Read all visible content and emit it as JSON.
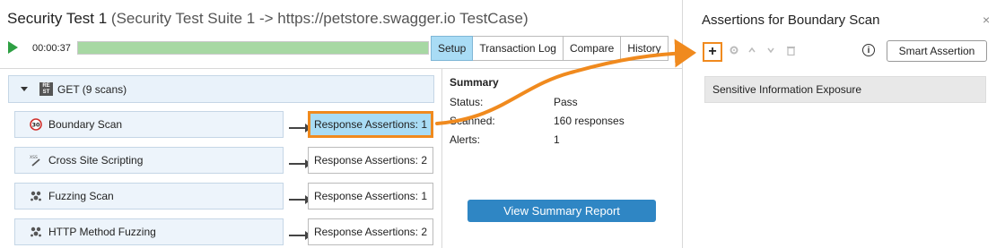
{
  "header": {
    "title": "Security Test 1",
    "subtitle": "(Security Test Suite 1 -> https://petstore.swagger.io TestCase)",
    "timer": "00:00:37",
    "progress": 1.0,
    "tabs": [
      "Setup",
      "Transaction Log",
      "Compare",
      "History"
    ],
    "active_tab": "Setup"
  },
  "group": {
    "label": "GET (9 scans)",
    "icon_text": "RE ST"
  },
  "scans": [
    {
      "name": "Boundary Scan",
      "icon": "boundary-icon",
      "assertions": "Response Assertions: 1",
      "highlighted": true
    },
    {
      "name": "Cross Site Scripting",
      "icon": "xss-icon",
      "assertions": "Response Assertions: 2",
      "highlighted": false
    },
    {
      "name": "Fuzzing Scan",
      "icon": "fuzzing-icon",
      "assertions": "Response Assertions: 1",
      "highlighted": false
    },
    {
      "name": "HTTP Method Fuzzing",
      "icon": "fuzzing-icon",
      "assertions": "Response Assertions: 2",
      "highlighted": false
    }
  ],
  "summary": {
    "title": "Summary",
    "rows": [
      {
        "label": "Status:",
        "value": "Pass"
      },
      {
        "label": "Scanned:",
        "value": "160 responses"
      },
      {
        "label": "Alerts:",
        "value": "1"
      }
    ],
    "report_button": "View Summary Report"
  },
  "assertions_panel": {
    "title": "Assertions for Boundary Scan",
    "close": "×",
    "add": "+",
    "smart_button": "Smart Assertion",
    "items": [
      "Sensitive Information Exposure"
    ]
  },
  "colors": {
    "accent": "#f08a1e",
    "tab_active": "#a9dcf5",
    "button": "#2f86c4",
    "play": "#2ea043"
  }
}
